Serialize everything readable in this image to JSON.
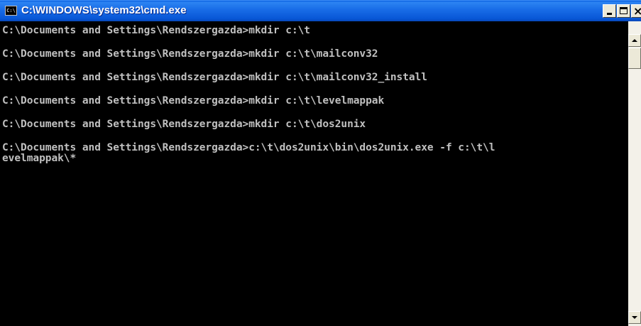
{
  "window": {
    "title": "C:\\WINDOWS\\system32\\cmd.exe",
    "icon": "console-icon",
    "icon_text": "C:\\"
  },
  "controls": {
    "minimize_icon": "minimize-icon",
    "maximize_icon": "maximize-icon",
    "close_glyph": "×"
  },
  "console": {
    "lines": [
      "C:\\Documents and Settings\\Rendszergazda>mkdir c:\\t",
      "C:\\Documents and Settings\\Rendszergazda>mkdir c:\\t\\mailconv32",
      "C:\\Documents and Settings\\Rendszergazda>mkdir c:\\t\\mailconv32_install",
      "C:\\Documents and Settings\\Rendszergazda>mkdir c:\\t\\levelmappak",
      "C:\\Documents and Settings\\Rendszergazda>mkdir c:\\t\\dos2unix",
      "C:\\Documents and Settings\\Rendszergazda>c:\\t\\dos2unix\\bin\\dos2unix.exe -f c:\\t\\l",
      "evelmappak\\*"
    ],
    "text_color": "#c0c0c0",
    "background": "#000000"
  },
  "colors": {
    "titlebar": "#0856d6"
  }
}
